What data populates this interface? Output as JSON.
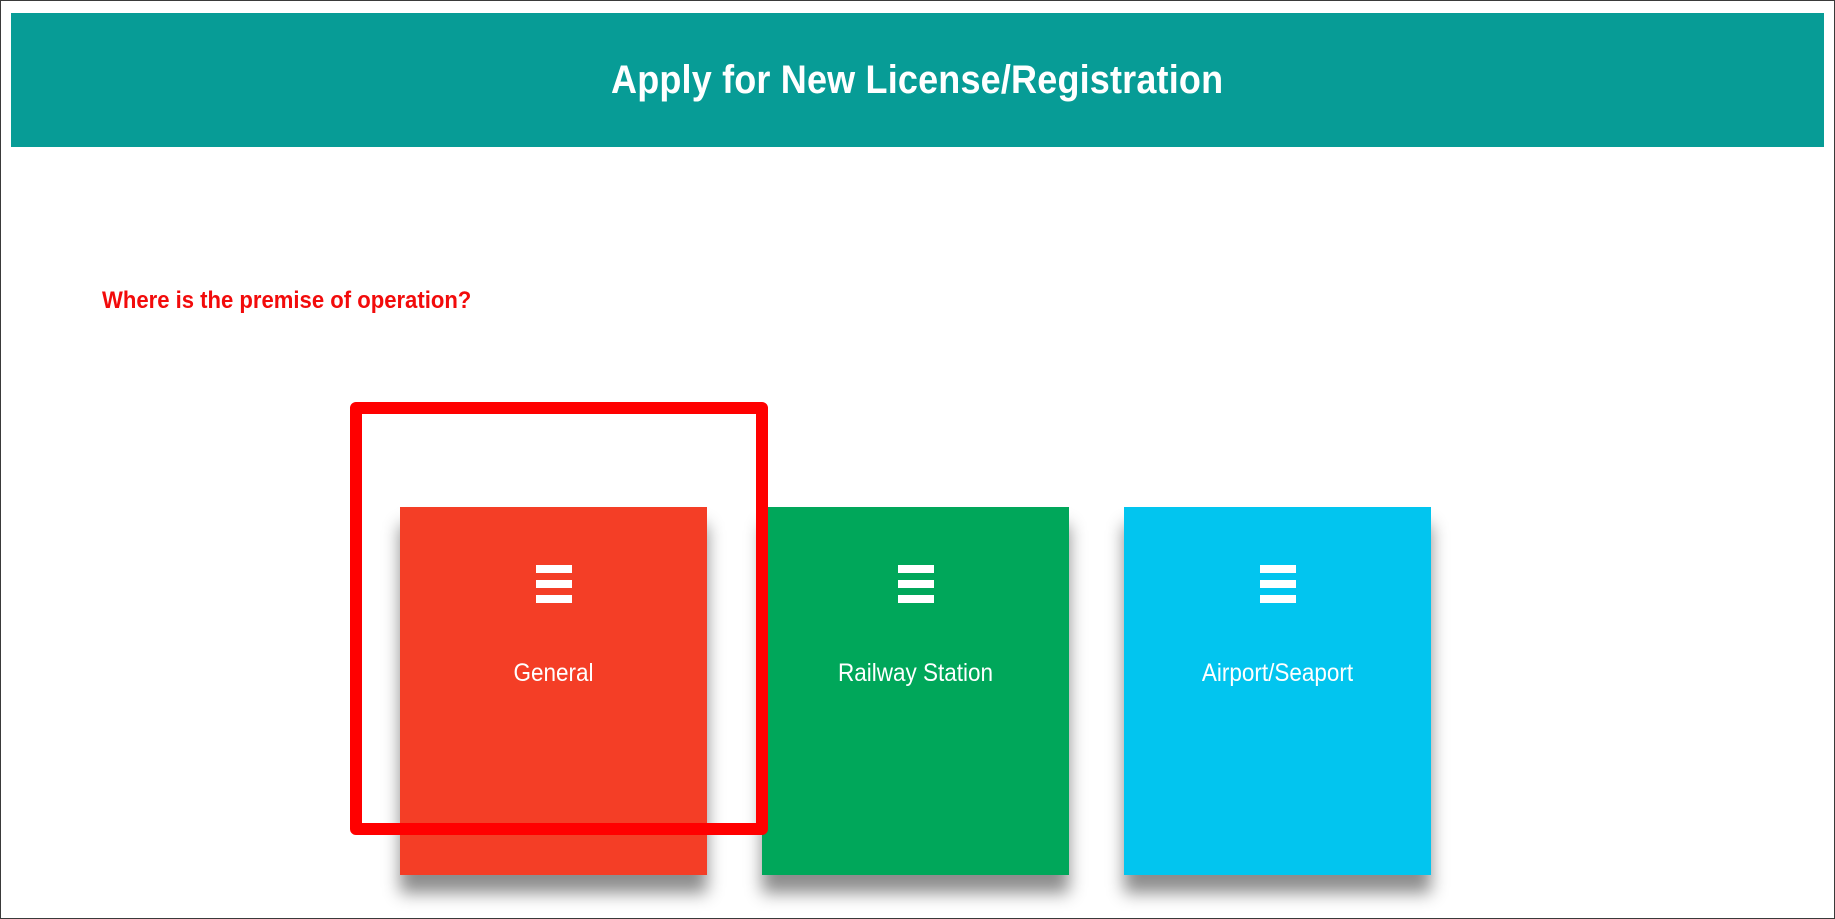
{
  "header": {
    "title": "Apply for New License/Registration"
  },
  "question": {
    "text": "Where is the premise of operation?"
  },
  "options": [
    {
      "label": "General",
      "icon": "menu-icon",
      "color": "#f43e26"
    },
    {
      "label": "Railway Station",
      "icon": "menu-icon",
      "color": "#00a75a"
    },
    {
      "label": "Airport/Seaport",
      "icon": "menu-icon",
      "color": "#02c5ef"
    }
  ],
  "colors": {
    "header_bg": "#079c96",
    "question_text": "#f20b0b",
    "highlight": "#ff0000"
  }
}
